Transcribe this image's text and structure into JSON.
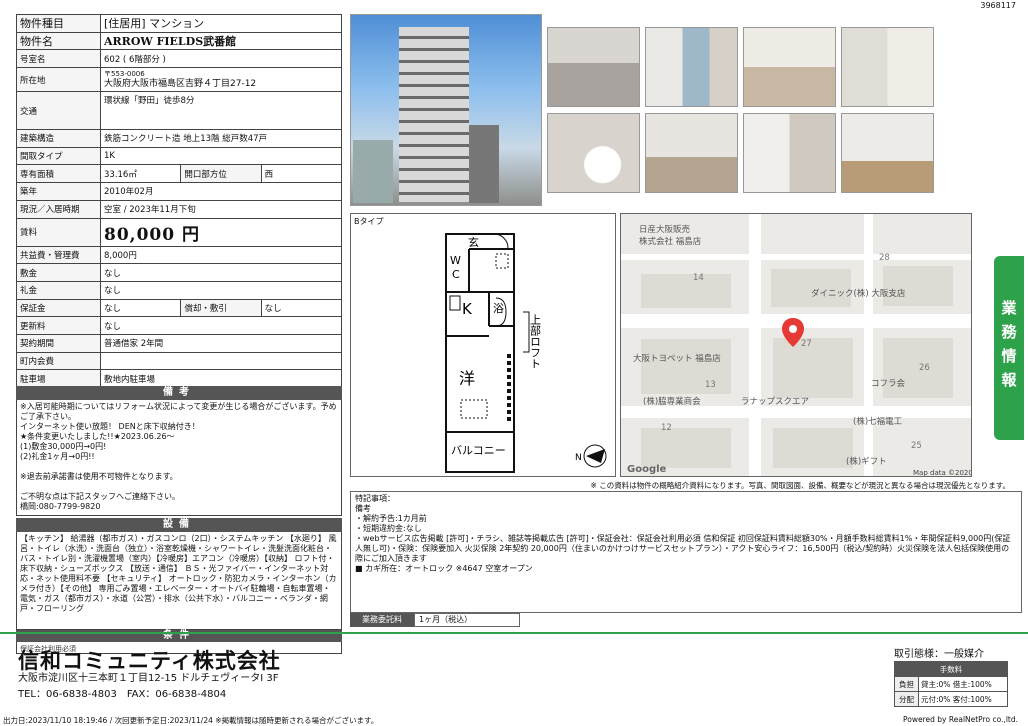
{
  "doc_id": "3968117",
  "info": {
    "type_label": "物件種目",
    "type_value": "[住居用] マンション",
    "name_label": "物件名",
    "name_value": "ARROW FIELDS武番館",
    "room_label": "号室名",
    "room_value": "602 ( 6階部分 )",
    "addr_label": "所在地",
    "addr_zip": "〒553-0006",
    "addr_value": "大阪府大阪市福島区吉野４丁目27-12",
    "traffic_label": "交通",
    "traffic_value": "環状線「野田」徒歩8分",
    "structure_label": "建築構造",
    "structure_value": "鉄筋コンクリート造 地上13階 総戸数47戸",
    "layout_label": "間取タイプ",
    "layout_value": "1K",
    "area_label": "専有面積",
    "area_value": "33.16㎡",
    "opening_label": "開口部方位",
    "opening_value": "西",
    "built_label": "築年",
    "built_value": "2010年02月",
    "status_label": "現況／入居時期",
    "status_value": "空室 / 2023年11月下旬",
    "rent_label": "賃料",
    "rent_value": "80,000 円",
    "fee_label": "共益費・管理費",
    "fee_value": "8,000円",
    "deposit_label": "敷金",
    "deposit_value": "なし",
    "key_label": "礼金",
    "key_value": "なし",
    "security_label": "保証金",
    "security_value": "なし",
    "amort_label": "償却・敷引",
    "amort_value": "なし",
    "renew_label": "更新料",
    "renew_value": "なし",
    "contract_label": "契約期間",
    "contract_value": "普通借家 2年間",
    "town_label": "町内会費",
    "town_value": "",
    "parking_label": "駐車場",
    "parking_value": "敷地内駐車場"
  },
  "remarks": {
    "header": "備考",
    "lines": [
      "※入居可能時期についてはリフォーム状況によって変更が生じる場合がございます。予めご了承下さい。",
      "インターネット使い放題！ DENと床下収納付き！",
      "★条件変更いたしました!!★2023.06.26～",
      "(1)敷金30,000円→0円!",
      "(2)礼金1ヶ月→0円!!",
      "",
      "※退去前承諾書は使用不可物件となります。",
      "",
      "ご不明な点は下記スタッフへご連絡下さい。",
      "橋岡:080-7799-9820"
    ]
  },
  "equipment": {
    "header": "設備",
    "text": "【キッチン】 給湯器（都市ガス）・ガスコンロ（2口）・システムキッチン 【水廻り】 風呂・トイレ（水洗）・洗面台（独立）・浴室乾燥機・シャワートイレ・洗髪洗面化粧台・バス・トイレ別・洗濯機置場（室内）【冷暖房】エアコン（冷暖房）【収納】 ロフト付・床下収納・シューズボックス 【放送・通信】 ＢＳ・光ファイバー・インターネット対応・ネット使用料不要 【セキュリティ】 オートロック・防犯カメラ・インターホン（カメラ付き）【その他】 専用ごみ置場・エレベーター・オートバイ駐輪場・自転車置場・電気・ガス（都市ガス）・水道（公営）・排水（公共下水）・バルコニー・ベランダ・網戸・フローリング"
  },
  "conditions": {
    "header": "条件",
    "text": "保証会社利用必須"
  },
  "plan": {
    "label": "Bタイプ",
    "rooms": {
      "entrance": "玄",
      "wc": "W\nC",
      "kitchen": "K",
      "bath": "浴",
      "western": "洋",
      "balcony": "バルコニー",
      "loft": "上部ロフト"
    }
  },
  "map": {
    "labels": [
      "日産大阪販売",
      "株式会社 福島店",
      "ダイニック(株) 大阪支店",
      "大阪トヨペット 福島店",
      "(株)脇専業商会",
      "ラナップスクエア",
      "コフラ会",
      "(株)七福電工",
      "(株)ギフト"
    ],
    "block_numbers": [
      "14",
      "28",
      "27",
      "13",
      "26",
      "12",
      "25"
    ],
    "google": "Google",
    "mapdata": "Map data ©2020"
  },
  "map_note": "※ この資料は物件の概略紹介資料になります。写真、間取図面、設備、概要などが現況と異なる場合は現況優先となります。",
  "notes": {
    "lines": [
      "特記事項：",
      "備考",
      "・解約予告:1カ月前",
      "・短期違約金:なし",
      "・webサービス広告掲載 [許可]・チラシ、雑誌等掲載広告 [許可]・保証会社：保証会社利用必須 信和保証 初回保証料賃料総額30%・月額手数料総賃料1%・年間保証料9,000円(保証人無し可)・保険：保険要加入 火災保険 2年契約 20,000円（住まいのかけつけサービスセットプラン）・アクト安心ライフ：16,500円（税込/契約時）火災保険を法人包括保険使用の際にご加入頂きます",
      "■ カギ所在：オートロック ※4647 空室オープン"
    ]
  },
  "fee": {
    "label": "業務委託料",
    "value": "1ヶ月（税込）"
  },
  "side_tab": "業務情報",
  "company": {
    "name": "信和コミュニティ株式会社",
    "address": "大阪市淀川区十三本町１丁目12-15 ドルチェヴィータⅠ 3F",
    "tel": "TEL：06-6838-4803　FAX：06-6838-4804"
  },
  "deal": {
    "type": "取引態様：一般媒介",
    "fee_header": "手数料",
    "rows": [
      {
        "k": "負担",
        "v": "貸主:0%  借主:100%"
      },
      {
        "k": "分配",
        "v": "元付:0%  客付:100%"
      }
    ]
  },
  "footer": {
    "left": "出力日:2023/11/10 18:19:46 / 次回更新予定日:2023/11/24 ※掲載情報は随時更新される場合がございます。",
    "right": "Powered by RealNetPro co.,ltd."
  }
}
